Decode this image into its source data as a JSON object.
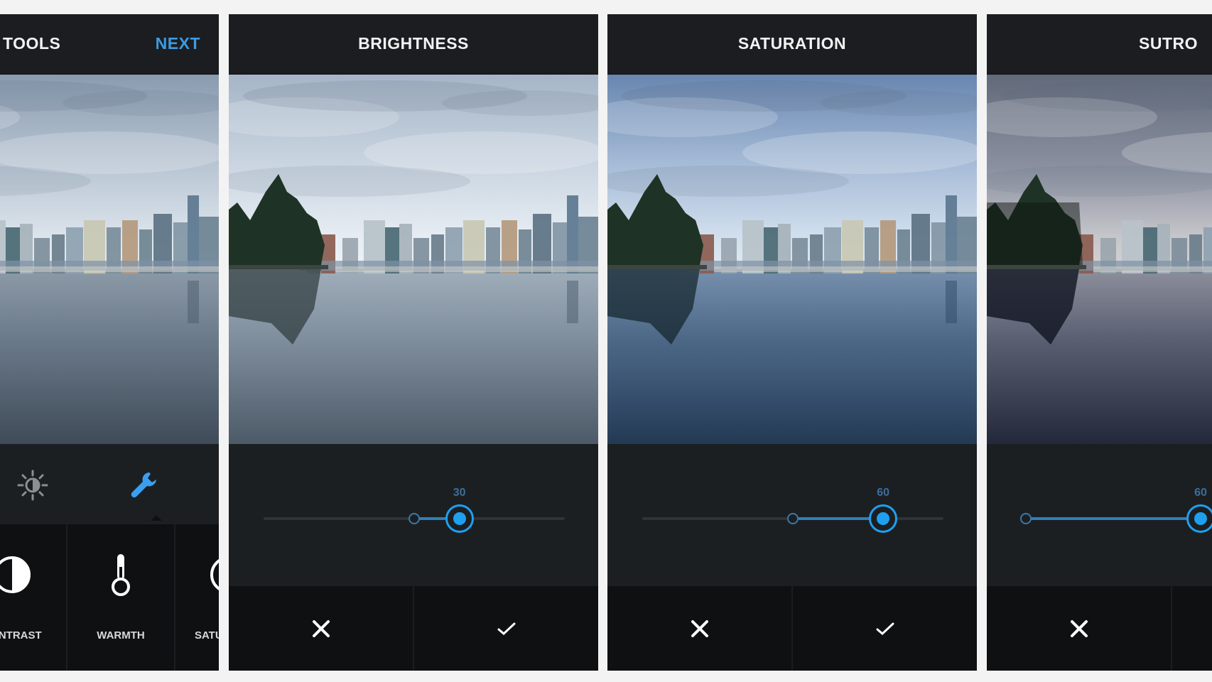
{
  "screens": [
    {
      "id": "tools",
      "header": {
        "title": "TOOLS",
        "action": "NEXT"
      },
      "tabs": [
        {
          "icon": "lux-icon",
          "active": false
        },
        {
          "icon": "wrench-icon",
          "active": true
        }
      ],
      "tools": [
        {
          "label": "CONTRAST",
          "icon": "contrast-icon"
        },
        {
          "label": "WARMTH",
          "icon": "thermometer-icon"
        },
        {
          "label": "SATURATION",
          "icon": "saturation-icon"
        }
      ]
    },
    {
      "id": "brightness",
      "header": {
        "title": "BRIGHTNESS"
      },
      "slider": {
        "value": 30,
        "display": "30",
        "min": -100,
        "max": 100,
        "origin": 0
      },
      "actions": {
        "cancel": "cancel-icon",
        "confirm": "check-icon"
      }
    },
    {
      "id": "saturation",
      "header": {
        "title": "SATURATION"
      },
      "slider": {
        "value": 60,
        "display": "60",
        "min": -100,
        "max": 100,
        "origin": 0
      },
      "actions": {
        "cancel": "cancel-icon",
        "confirm": "check-icon"
      }
    },
    {
      "id": "sutro",
      "header": {
        "title": "SUTRO"
      },
      "slider": {
        "value": 60,
        "display": "60",
        "min": 0,
        "max": 100,
        "origin": 0
      },
      "actions": {
        "cancel": "cancel-icon",
        "confirm": "check-icon"
      }
    }
  ],
  "colors": {
    "accent": "#1ea0f0",
    "next_link": "#3d9be0",
    "header_bg": "#1b1d20",
    "control_bg": "#1c1f22",
    "action_bar_bg": "#0f1011",
    "page_bg": "#f3f3f3"
  }
}
